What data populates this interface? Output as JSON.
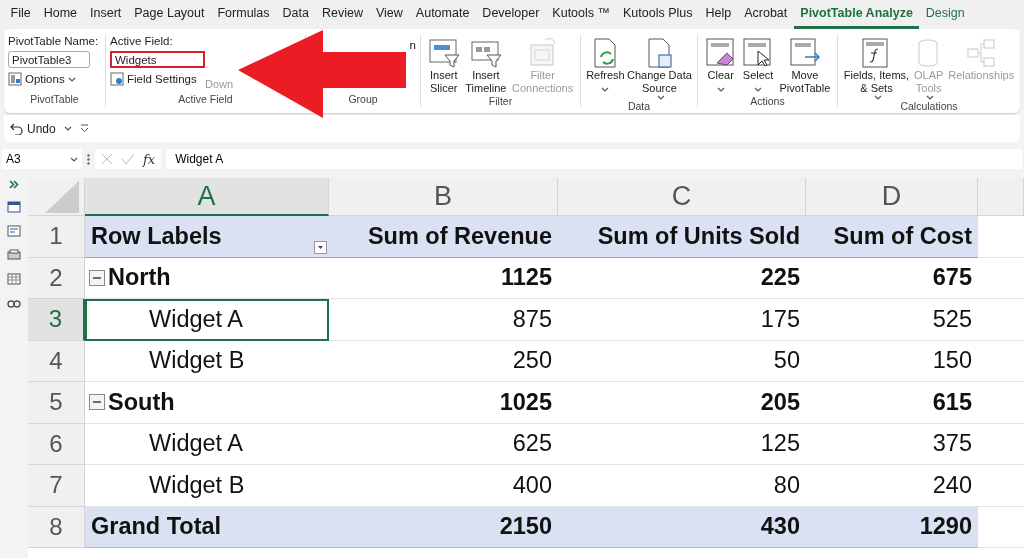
{
  "menu_tabs": [
    {
      "label": "File",
      "selected": false
    },
    {
      "label": "Home",
      "selected": false
    },
    {
      "label": "Insert",
      "selected": false
    },
    {
      "label": "Page Layout",
      "selected": false
    },
    {
      "label": "Formulas",
      "selected": false
    },
    {
      "label": "Data",
      "selected": false
    },
    {
      "label": "Review",
      "selected": false
    },
    {
      "label": "View",
      "selected": false
    },
    {
      "label": "Automate",
      "selected": false
    },
    {
      "label": "Developer",
      "selected": false
    },
    {
      "label": "Kutools ™",
      "selected": false
    },
    {
      "label": "Kutools Plus",
      "selected": false
    },
    {
      "label": "Help",
      "selected": false
    },
    {
      "label": "Acrobat",
      "selected": false
    },
    {
      "label": "PivotTable Analyze",
      "selected": true
    },
    {
      "label": "Design",
      "selected": false
    }
  ],
  "ribbon": {
    "pivottable": {
      "name_label": "PivotTable Name:",
      "name_value": "PivotTable3",
      "options_button": "Options",
      "group_label": "PivotTable"
    },
    "active_field": {
      "field_label": "Active Field:",
      "field_value": "Widgets",
      "settings_button": "Field Settings",
      "drill_button": "Down",
      "group_label": "Active Field"
    },
    "group": {
      "partial_text": "n",
      "group_label": "Group"
    },
    "groups": [
      {
        "label": "Filter",
        "buttons": [
          {
            "lines": [
              "Insert",
              "Slicer"
            ],
            "disabled": false,
            "dropdown": false
          },
          {
            "lines": [
              "Insert",
              "Timeline"
            ],
            "disabled": false,
            "dropdown": false
          },
          {
            "lines": [
              "Filter",
              "Connections"
            ],
            "disabled": true,
            "dropdown": false
          }
        ]
      },
      {
        "label": "Data",
        "buttons": [
          {
            "lines": [
              "Refresh"
            ],
            "disabled": false,
            "dropdown": true
          },
          {
            "lines": [
              "Change Data",
              "Source"
            ],
            "disabled": false,
            "dropdown": true
          }
        ]
      },
      {
        "label": "Actions",
        "buttons": [
          {
            "lines": [
              "Clear"
            ],
            "disabled": false,
            "dropdown": true
          },
          {
            "lines": [
              "Select"
            ],
            "disabled": false,
            "dropdown": true
          },
          {
            "lines": [
              "Move",
              "PivotTable"
            ],
            "disabled": false,
            "dropdown": false
          }
        ]
      },
      {
        "label": "Calculations",
        "buttons": [
          {
            "lines": [
              "Fields, Items,",
              "& Sets"
            ],
            "disabled": false,
            "dropdown": true
          },
          {
            "lines": [
              "OLAP",
              "Tools"
            ],
            "disabled": true,
            "dropdown": true
          },
          {
            "lines": [
              "Relationships"
            ],
            "disabled": true,
            "dropdown": false
          }
        ]
      }
    ]
  },
  "quick_access": {
    "undo": "Undo"
  },
  "formula_bar": {
    "name_box": "A3",
    "function_symbol": "fx",
    "formula": "Widget A"
  },
  "sheet": {
    "columns": [
      {
        "label": "A",
        "selected": true
      },
      {
        "label": "B",
        "selected": false
      },
      {
        "label": "C",
        "selected": false
      },
      {
        "label": "D",
        "selected": false
      }
    ],
    "rows": [
      {
        "number": "1",
        "selected": false,
        "kind": "header",
        "cells": [
          "Row Labels",
          "Sum of Revenue",
          "Sum of Units Sold",
          "Sum of Cost"
        ]
      },
      {
        "number": "2",
        "selected": false,
        "kind": "group",
        "expanded": true,
        "cells": [
          "North",
          "1125",
          "225",
          "675"
        ]
      },
      {
        "number": "3",
        "selected": true,
        "kind": "item",
        "cells": [
          "Widget A",
          "875",
          "175",
          "525"
        ]
      },
      {
        "number": "4",
        "selected": false,
        "kind": "item",
        "cells": [
          "Widget B",
          "250",
          "50",
          "150"
        ]
      },
      {
        "number": "5",
        "selected": false,
        "kind": "group",
        "expanded": true,
        "cells": [
          "South",
          "1025",
          "205",
          "615"
        ]
      },
      {
        "number": "6",
        "selected": false,
        "kind": "item",
        "cells": [
          "Widget A",
          "625",
          "125",
          "375"
        ]
      },
      {
        "number": "7",
        "selected": false,
        "kind": "item",
        "cells": [
          "Widget B",
          "400",
          "80",
          "240"
        ]
      },
      {
        "number": "8",
        "selected": false,
        "kind": "total",
        "cells": [
          "Grand Total",
          "2150",
          "430",
          "1290"
        ]
      }
    ]
  }
}
